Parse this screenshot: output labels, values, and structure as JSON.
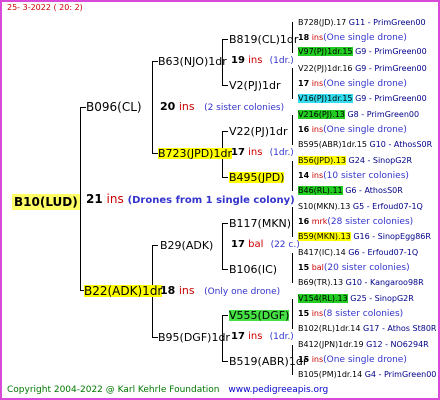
{
  "header": {
    "date": "25-  3-2022 ( 20:  2)"
  },
  "root": {
    "name": "B10(LUD)",
    "ins": "21",
    "ins_label": "ins",
    "note": "(Drones from 1 single colony)"
  },
  "gen1": [
    {
      "name": "B096(CL)",
      "ins": "20",
      "ins_label": "ins",
      "note": "(2 sister colonies)"
    },
    {
      "name": "B22(ADK)1dr",
      "ins": "18",
      "ins_label": "ins",
      "note": "(Only one drone)"
    }
  ],
  "gen2": [
    {
      "name": "B63(NJO)1dr",
      "ins": "19",
      "ins_label": "ins",
      "note": "(1dr.)"
    },
    {
      "name": "B723(JPD)1dr",
      "ins": "17",
      "ins_label": "ins",
      "note": "(1dr.)"
    },
    {
      "name": "B29(ADK)",
      "ins": "17",
      "ins_label": "bal",
      "note": "(22 c.)"
    },
    {
      "name": "B95(DGF)1dr",
      "ins": "17",
      "ins_label": "ins",
      "note": "(1dr.)"
    }
  ],
  "gen3": [
    {
      "name": "B819(CL)1dr"
    },
    {
      "name": "V2(PJ)1dr"
    },
    {
      "name": "V22(PJ)1dr"
    },
    {
      "name": "B495(JPD)"
    },
    {
      "name": "B117(MKN)"
    },
    {
      "name": "B106(IC)"
    },
    {
      "name": "V555(DGF)"
    },
    {
      "name": "B519(ABR)1dr"
    }
  ],
  "gen4": [
    {
      "name": "B728(JD).17",
      "source": "G11 - PrimGreen00"
    },
    {
      "ins": "18",
      "ins_label": "ins",
      "note": "(One single drone)"
    },
    {
      "name": "V97(PJ)1dr.15",
      "source": "G9 - PrimGreen00"
    },
    {
      "name": "V22(PJ)1dr.16",
      "source": "G9 - PrimGreen00"
    },
    {
      "ins": "17",
      "ins_label": "ins",
      "note": "(One single drone)"
    },
    {
      "name": "V16(PJ)1dr.15",
      "source": "G9 - PrimGreen00"
    },
    {
      "name": "V216(PJ).13",
      "source": "G8 - PrimGreen00"
    },
    {
      "ins": "16",
      "ins_label": "ins",
      "note": "(One single drone)"
    },
    {
      "name": "B595(ABR)1dr.15",
      "source": "G10 - AthosS0R"
    },
    {
      "name": "B56(JPD).13",
      "source": "G24 - SinopG2R"
    },
    {
      "ins": "14",
      "ins_label": "ins",
      "note": "(10 sister colonies)"
    },
    {
      "name": "B46(RL).11",
      "source": "G6 - AthosS0R"
    },
    {
      "name": "S10(MKN).13",
      "source": "G5 - Erfoud07-1Q"
    },
    {
      "ins": "16",
      "ins_label": "mrk",
      "note": "(28 sister colonies)"
    },
    {
      "name": "B59(MKN).13",
      "source": "G16 - SinopEgg86R"
    },
    {
      "name": "B417(IC).14",
      "source": "G6 - Erfoud07-1Q"
    },
    {
      "ins": "15",
      "ins_label": "bal",
      "note": "(20 sister colonies)"
    },
    {
      "name": "B69(TR).13",
      "source": "G10 - Kangaroo98R"
    },
    {
      "name": "V154(RL).13",
      "source": "G25 - SinopG2R"
    },
    {
      "ins": "15",
      "ins_label": "ins",
      "note": "(8 sister colonies)"
    },
    {
      "name": "B102(RL)1dr.14",
      "source": "G17 - Athos St80R"
    },
    {
      "name": "B412(JPN)1dr.19",
      "source": "G12 - NO6294R"
    },
    {
      "ins": "15",
      "ins_label": "ins",
      "note": "(One single drone)"
    },
    {
      "name": "B105(PM)1dr.14",
      "source": "G4 - PrimGreen00"
    }
  ],
  "footer": {
    "copyright": "Copyright 2004-2022 @ Karl Kehrle Foundation",
    "site": "www.pedigreeapis.org"
  }
}
